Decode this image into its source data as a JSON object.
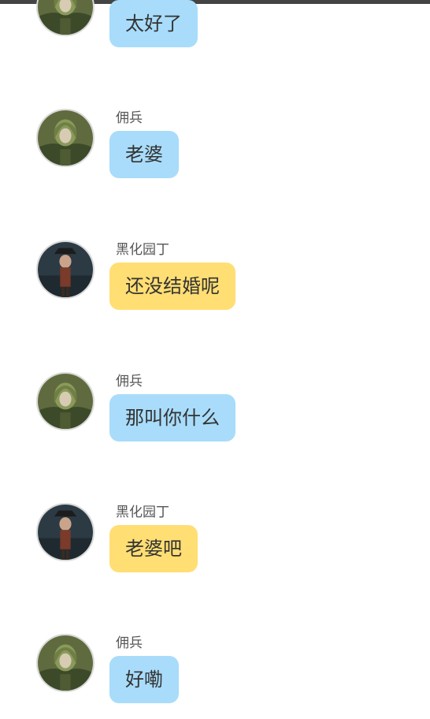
{
  "colors": {
    "blue_bubble": "#a8dcfa",
    "yellow_bubble": "#ffde73",
    "name_text": "#555555",
    "top_bar": "#444444"
  },
  "messages": [
    {
      "sender": "",
      "avatar": "mercenary-avatar",
      "text": "太好了",
      "bubble": "blue"
    },
    {
      "sender": "佣兵",
      "avatar": "mercenary-avatar",
      "text": "老婆",
      "bubble": "blue"
    },
    {
      "sender": "黑化园丁",
      "avatar": "dark-gardener-avatar",
      "text": "还没结婚呢",
      "bubble": "yellow"
    },
    {
      "sender": "佣兵",
      "avatar": "mercenary-avatar",
      "text": "那叫你什么",
      "bubble": "blue"
    },
    {
      "sender": "黑化园丁",
      "avatar": "dark-gardener-avatar",
      "text": "老婆吧",
      "bubble": "yellow"
    },
    {
      "sender": "佣兵",
      "avatar": "mercenary-avatar",
      "text": "好嘞",
      "bubble": "blue"
    }
  ]
}
